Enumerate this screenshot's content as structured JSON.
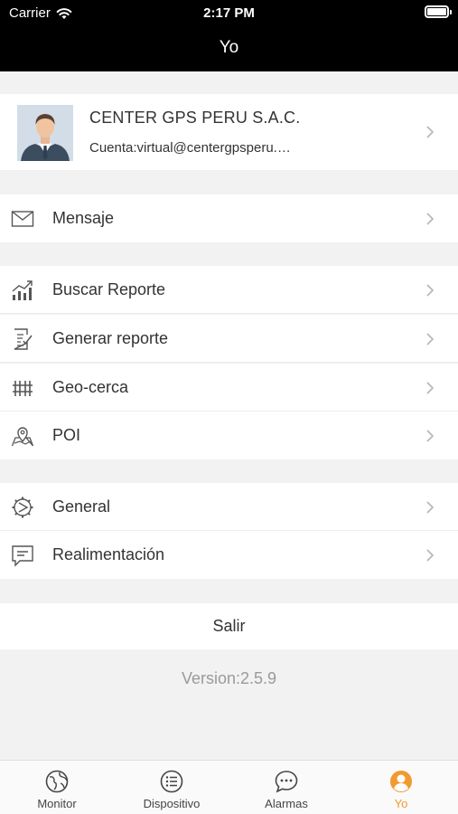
{
  "status_bar": {
    "carrier": "Carrier",
    "time": "2:17 PM"
  },
  "nav": {
    "title": "Yo"
  },
  "profile": {
    "name": "CENTER GPS PERU S.A.C.",
    "account": "Cuenta:virtual@centergpsperu.…"
  },
  "menu": {
    "message": "Mensaje",
    "search_report": "Buscar Reporte",
    "generate_report": "Generar reporte",
    "geofence": "Geo-cerca",
    "poi": "POI",
    "general": "General",
    "feedback": "Realimentación"
  },
  "logout_label": "Salir",
  "version": "Version:2.5.9",
  "tabs": [
    {
      "label": "Monitor",
      "icon": "globe-icon"
    },
    {
      "label": "Dispositivo",
      "icon": "list-icon"
    },
    {
      "label": "Alarmas",
      "icon": "chat-icon"
    },
    {
      "label": "Yo",
      "icon": "person-icon"
    }
  ],
  "colors": {
    "accent": "#f29a2e",
    "header": "#000000",
    "background": "#f2f2f2"
  }
}
